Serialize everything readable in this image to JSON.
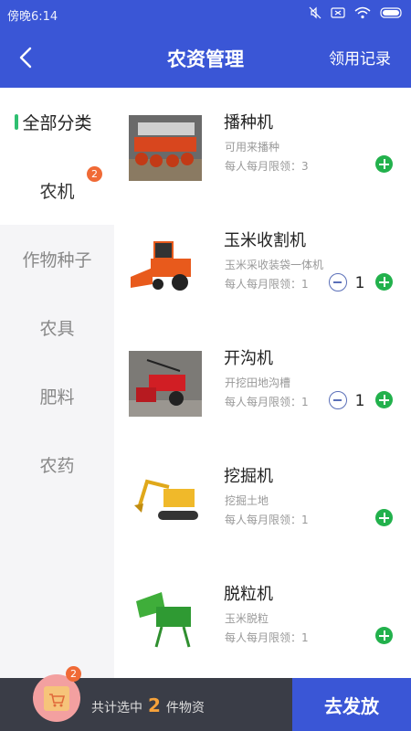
{
  "status_bar": {
    "time": "傍晚6:14"
  },
  "header": {
    "title": "农资管理",
    "records_link": "领用记录"
  },
  "sidebar": {
    "items": [
      {
        "label": "全部分类",
        "state": "active"
      },
      {
        "label": "农机",
        "badge": "2",
        "state": "current"
      },
      {
        "label": "作物种子"
      },
      {
        "label": "农具"
      },
      {
        "label": "肥料"
      },
      {
        "label": "农药"
      }
    ]
  },
  "products": [
    {
      "name": "播种机",
      "desc": "可用来播种",
      "limit": "每人每月限领：3",
      "qty": ""
    },
    {
      "name": "玉米收割机",
      "desc": "玉米采收装袋一体机",
      "limit": "每人每月限领：1",
      "qty": "1"
    },
    {
      "name": "开沟机",
      "desc": "开挖田地沟槽",
      "limit": "每人每月限领：1",
      "qty": "1"
    },
    {
      "name": "挖掘机",
      "desc": "挖掘土地",
      "limit": "每人每月限领：1",
      "qty": ""
    },
    {
      "name": "脱粒机",
      "desc": "玉米脱粒",
      "limit": "每人每月限领：1",
      "qty": ""
    }
  ],
  "footer": {
    "cart_badge": "2",
    "summary_prefix": "共计选中",
    "summary_count": "2",
    "summary_suffix": "件物资",
    "dispatch_label": "去发放"
  },
  "colors": {
    "primary": "#3a56d6",
    "accent_green": "#22b14c",
    "badge_orange": "#f06a36",
    "footer_bg": "#3a3d47"
  }
}
